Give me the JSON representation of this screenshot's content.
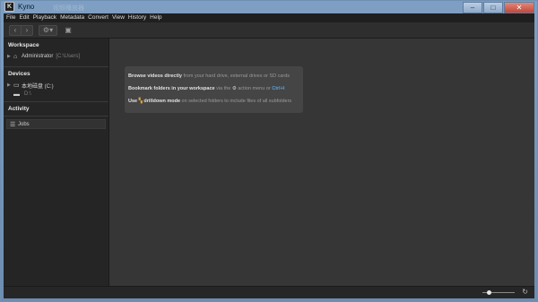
{
  "window": {
    "app_icon_letter": "K",
    "title": "Kyno",
    "ghost_title": "视频播放器",
    "controls": {
      "minimize": "–",
      "maximize": "□",
      "close": "✕"
    }
  },
  "menu": [
    "File",
    "Edit",
    "Playback",
    "Metadata",
    "Convert",
    "View",
    "History",
    "Help"
  ],
  "toolbar": {
    "back_icon": "chevron-left-icon",
    "forward_icon": "chevron-right-icon",
    "settings_icon": "gear-icon",
    "bookmark_icon": "bookmark-folder-icon"
  },
  "sidebar": {
    "workspace": {
      "title": "Workspace",
      "items": [
        {
          "label": "Administrator",
          "path": "[C:\\Users]",
          "icon": "home-icon"
        }
      ]
    },
    "devices": {
      "title": "Devices",
      "items": [
        {
          "label": "本地磁盘 (C:)",
          "icon": "drive-icon"
        },
        {
          "label": "D:\\",
          "icon": "folder-icon"
        }
      ]
    },
    "activity": {
      "title": "Activity",
      "items": [
        {
          "label": "Jobs",
          "icon": "list-icon"
        }
      ]
    }
  },
  "tips": {
    "line1_bold": "Browse videos directly",
    "line1_rest": " from your hard drive, external drives or SD cards",
    "line2_bold": "Bookmark folders in your workspace",
    "line2_mid": " via the ",
    "line2_rest": " action menu or ",
    "line2_key": "Ctrl+I",
    "line3_use": "Use ",
    "line3_bold": "drilldown mode",
    "line3_rest": " on selected folders to include files of all subfolders"
  },
  "status": {
    "zoom_level": 0.15
  }
}
